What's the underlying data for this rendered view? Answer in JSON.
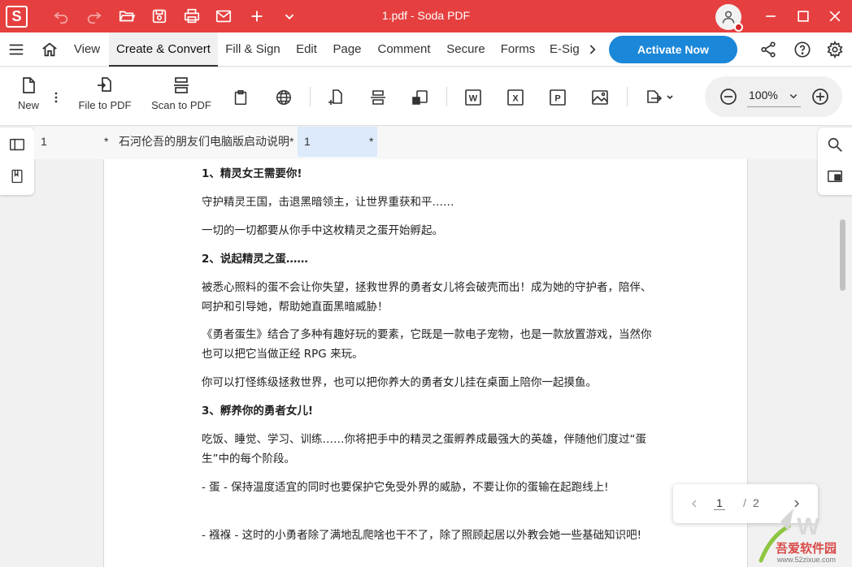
{
  "app": {
    "logo_letter": "S",
    "window_title": "1.pdf  -  Soda PDF"
  },
  "titlebar": {
    "icons": [
      "undo-icon",
      "redo-icon",
      "open-folder-icon",
      "save-icon",
      "print-icon",
      "mail-icon",
      "plus-icon",
      "chevron-down-icon"
    ],
    "accent": "#e5403f"
  },
  "menubar": {
    "items": [
      "View",
      "Create & Convert",
      "Fill & Sign",
      "Edit",
      "Page",
      "Comment",
      "Secure",
      "Forms",
      "E-Sig"
    ],
    "active": "Create & Convert",
    "activate_label": "Activate Now",
    "activate_color": "#1b87d8"
  },
  "toolbar": {
    "new_label": "New",
    "file_to_pdf_label": "File to PDF",
    "scan_to_pdf_label": "Scan to PDF",
    "zoom_value": "100%"
  },
  "tabs": [
    {
      "name": "1",
      "modified": "*"
    },
    {
      "name": "石河伦吾的朋友们电脑版启动说明",
      "modified": "*"
    },
    {
      "name": "1",
      "modified": "*"
    }
  ],
  "document": {
    "paragraphs": [
      {
        "text": "1、精灵女王需要你!",
        "bold": true
      },
      {
        "text": "守护精灵王国，击退黑暗领主，让世界重获和平……",
        "bold": false
      },
      {
        "text": "一切的一切都要从你手中这枚精灵之蛋开始孵起。",
        "bold": false
      },
      {
        "text": "2、说起精灵之蛋……",
        "bold": true
      },
      {
        "text": "被悉心照料的蛋不会让你失望，拯救世界的勇者女儿将会破壳而出！成为她的守护者，陪伴、呵护和引导她，帮助她直面黑暗威胁！",
        "bold": false
      },
      {
        "text": "《勇者蛋生》结合了多种有趣好玩的要素，它既是一款电子宠物，也是一款放置游戏，当然你也可以把它当做正经 RPG 来玩。",
        "bold": false
      },
      {
        "text": "你可以打怪练级拯救世界，也可以把你养大的勇者女儿挂在桌面上陪你一起摸鱼。",
        "bold": false
      },
      {
        "text": "3、孵养你的勇者女儿!",
        "bold": true
      },
      {
        "text": "吃饭、睡觉、学习、训练……你将把手中的精灵之蛋孵养成最强大的英雄，伴随他们度过“蛋生”中的每个阶段。",
        "bold": false
      },
      {
        "text": "- 蛋 - 保持温度适宜的同时也要保护它免受外界的威胁，不要让你的蛋输在起跑线上!",
        "bold": false
      },
      {
        "text": "- 襁褓 - 这时的小勇者除了满地乱爬啥也干不了，除了照顾起居以外教会她一些基础知识吧!",
        "bold": false
      }
    ]
  },
  "pagenav": {
    "current": "1",
    "separator": "/",
    "total": "2"
  },
  "watermark": {
    "text": "吾爱软件园",
    "url": "www.52zixue.com"
  }
}
